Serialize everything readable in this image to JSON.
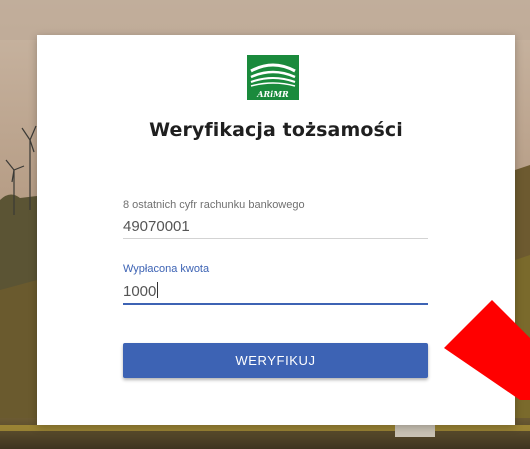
{
  "brand": {
    "logo_text": "ARiMR",
    "colors": {
      "green": "#1a8a3c",
      "primary": "#3d63b4",
      "annotation": "#ff0000"
    }
  },
  "dialog": {
    "title": "Weryfikacja tożsamości"
  },
  "form": {
    "account_digits": {
      "label": "8 ostatnich cyfr rachunku bankowego",
      "value": "49070001"
    },
    "paid_amount": {
      "label": "Wypłacona kwota",
      "value": "1000"
    },
    "submit_label": "WERYFIKUJ"
  },
  "overlay": {
    "icon": "red-arrow-icon"
  }
}
